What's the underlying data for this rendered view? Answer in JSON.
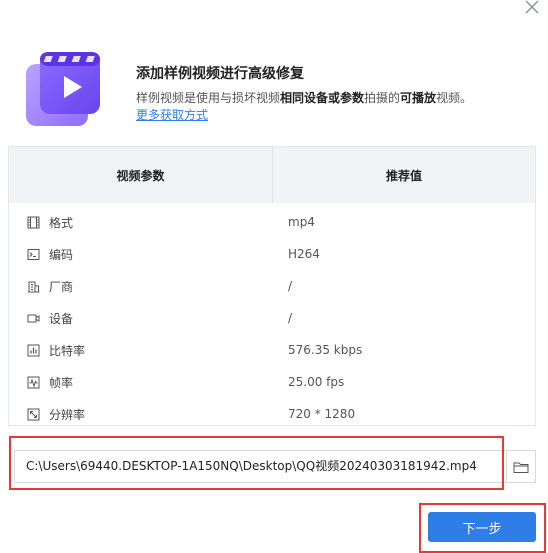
{
  "header": {
    "title": "添加样例视频进行高级修复",
    "desc_1": "样例视频是使用与损坏视频",
    "desc_2": "相同设备或参数",
    "desc_3": "拍摄的",
    "desc_4": "可播放",
    "desc_5": "视频。",
    "more_link": "更多获取方式"
  },
  "table": {
    "col_param": "视频参数",
    "col_recommend": "推荐值",
    "rows": [
      {
        "label": "格式",
        "value": "mp4",
        "icon": "film-icon"
      },
      {
        "label": "编码",
        "value": "H264",
        "icon": "code-icon"
      },
      {
        "label": "厂商",
        "value": "/",
        "icon": "building-icon"
      },
      {
        "label": "设备",
        "value": "/",
        "icon": "camera-icon"
      },
      {
        "label": "比特率",
        "value": "576.35 kbps",
        "icon": "bar-chart-icon"
      },
      {
        "label": "帧率",
        "value": "25.00 fps",
        "icon": "waveform-icon"
      },
      {
        "label": "分辨率",
        "value": "720 * 1280",
        "icon": "resize-icon"
      }
    ]
  },
  "path": {
    "value": "C:\\Users\\69440.DESKTOP-1A150NQ\\Desktop\\QQ视频20240303181942.mp4"
  },
  "footer": {
    "next_label": "下一步"
  },
  "colors": {
    "accent": "#2f7ee8",
    "highlight": "#e53935",
    "icon_purple": "#7b5cf5"
  }
}
